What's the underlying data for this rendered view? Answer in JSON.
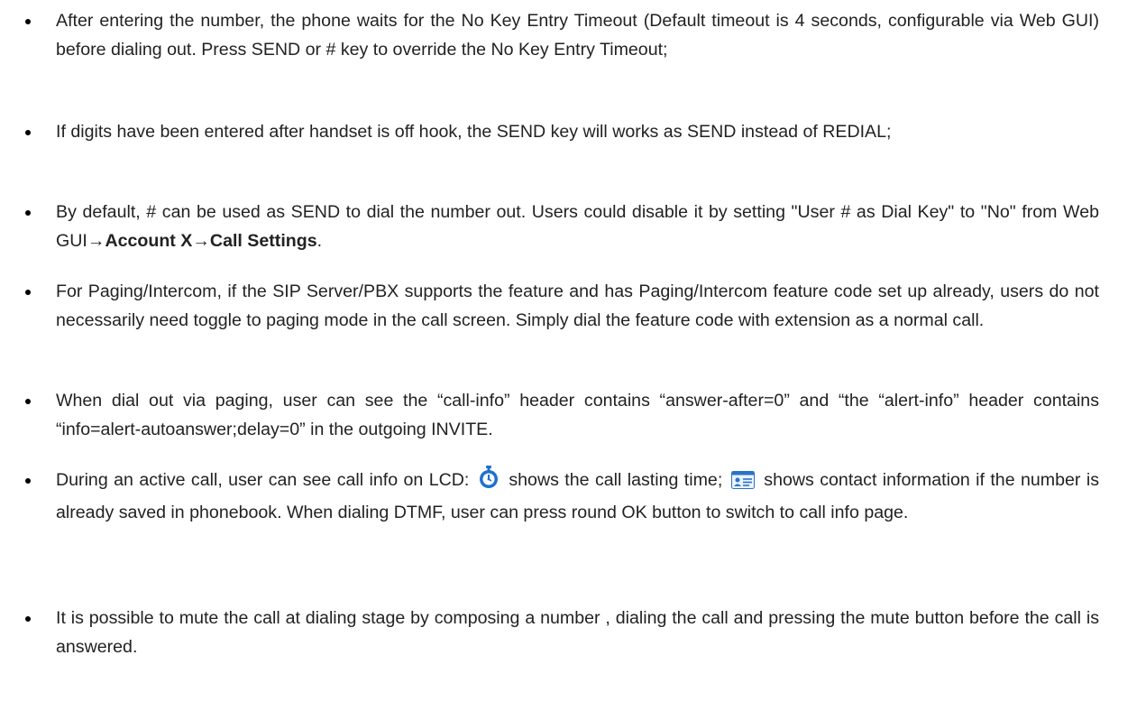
{
  "bullets": [
    {
      "text": "After entering the number, the phone waits for the No Key Entry Timeout (Default timeout is 4 seconds, configurable via Web GUI) before dialing out. Press SEND or # key to override the No Key Entry Timeout;"
    },
    {
      "text": "If digits have been entered after handset is off hook, the SEND key will works as SEND instead of REDIAL;"
    },
    {
      "part1": "By default, # can be used as SEND to dial the number out. Users could disable it by setting \"User # as Dial Key\" to \"No\" from Web GUI",
      "arrow1": "→",
      "bold1": "Account X",
      "arrow2": "→",
      "bold2": "Call Settings",
      "end": "."
    },
    {
      "text": "For Paging/Intercom, if the SIP Server/PBX supports the feature and has Paging/Intercom feature code set up already, users do not necessarily need toggle to paging mode in the call screen. Simply dial the feature code with extension as a normal call."
    },
    {
      "text": "When dial out via paging, user can see the “call-info” header contains “answer-after=0” and “the “alert-info” header contains “info=alert-autoanswer;delay=0” in the outgoing INVITE."
    },
    {
      "part1": "During an active call, user can see call info on LCD:",
      "icon1": "stopwatch-icon",
      "part2": "shows the call lasting time;",
      "icon2": "contact-card-icon",
      "part3": "shows contact information if the number is already saved in phonebook. When dialing DTMF, user can press round OK button to switch to call info page."
    },
    {
      "text": "It is possible to mute the call at dialing stage by composing a number , dialing the call and pressing the mute button before the call is answered."
    }
  ],
  "colors": {
    "text": "#222222",
    "stopwatch_blue": "#1f6fd1",
    "card_blue": "#2a72c9"
  }
}
